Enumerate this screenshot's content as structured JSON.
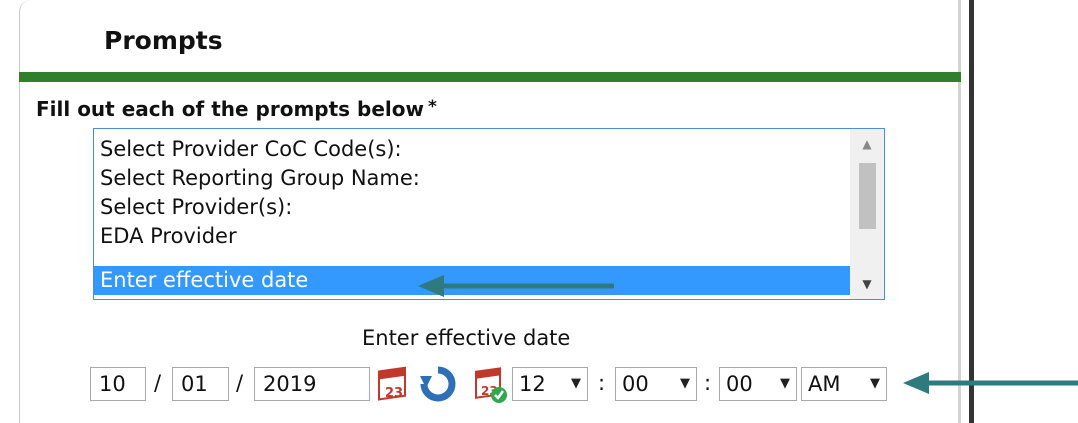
{
  "panel": {
    "title": "Prompts"
  },
  "prompts": {
    "heading": "Fill out each of the prompts below",
    "required_marker": "*",
    "items": [
      {
        "label": "Select Provider CoC Code(s):"
      },
      {
        "label": "Select Reporting Group Name:"
      },
      {
        "label": "Select Provider(s):"
      },
      {
        "label": "EDA Provider"
      },
      {
        "label": "Enter effective date",
        "selected": true
      }
    ]
  },
  "effective_date": {
    "label": "Enter effective date",
    "month": "10",
    "day": "01",
    "year": "2019",
    "date_separator": "/",
    "time_separator": ":",
    "hour": "12",
    "minute": "00",
    "second": "00",
    "ampm": "AM"
  },
  "icons": {
    "calendar": "calendar-icon",
    "refresh": "refresh-icon",
    "calendar_check": "calendar-check-icon",
    "annotation_arrow": "arrow-left-icon"
  },
  "colors": {
    "green_rule": "#2f7f2c",
    "selection": "#3399ff",
    "arrow": "#2e7a7f",
    "calendar_red": "#c0392b",
    "refresh_blue": "#2f6fb5",
    "check_green": "#2fa84f"
  }
}
